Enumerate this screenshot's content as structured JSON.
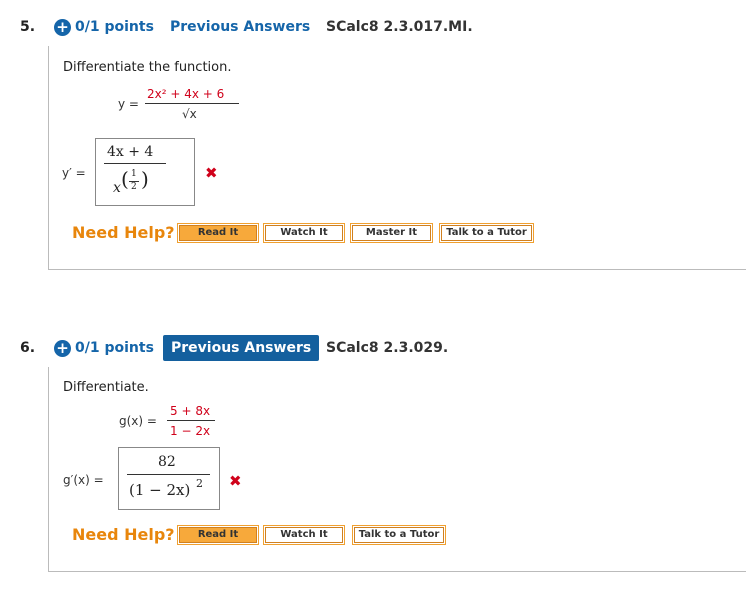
{
  "q5": {
    "number": "5.",
    "points": "0/1 points",
    "prev_answers": "Previous Answers",
    "code": "SCalc8 2.3.017.MI.",
    "prompt": "Differentiate the function.",
    "func_lhs": "y =",
    "func_num": "2x² + 4x + 6",
    "func_den": "√x",
    "ans_lhs": "y′ =",
    "ans_num": "4x + 4",
    "ans_den_base": "x",
    "ans_den_exp_num": "1",
    "ans_den_exp_den": "2",
    "result_icon": "x-mark-icon",
    "need_help": "Need Help?",
    "help_buttons": [
      "Read It",
      "Watch It",
      "Master It",
      "Talk to a Tutor"
    ]
  },
  "q6": {
    "number": "6.",
    "points": "0/1 points",
    "prev_answers": "Previous Answers",
    "code": "SCalc8 2.3.029.",
    "prompt": "Differentiate.",
    "func_lhs": "g(x) =",
    "func_num": "5 + 8x",
    "func_den": "1 − 2x",
    "ans_lhs": "g′(x) =",
    "ans_num": "82",
    "ans_den": "(1 − 2x)",
    "ans_den_exp": "2",
    "result_icon": "x-mark-icon",
    "need_help": "Need Help?",
    "help_buttons": [
      "Read It",
      "Watch It",
      "Talk to a Tutor"
    ]
  },
  "colors": {
    "link_blue": "#1565a9",
    "help_orange": "#e8860c",
    "error_red": "#d0021b"
  }
}
